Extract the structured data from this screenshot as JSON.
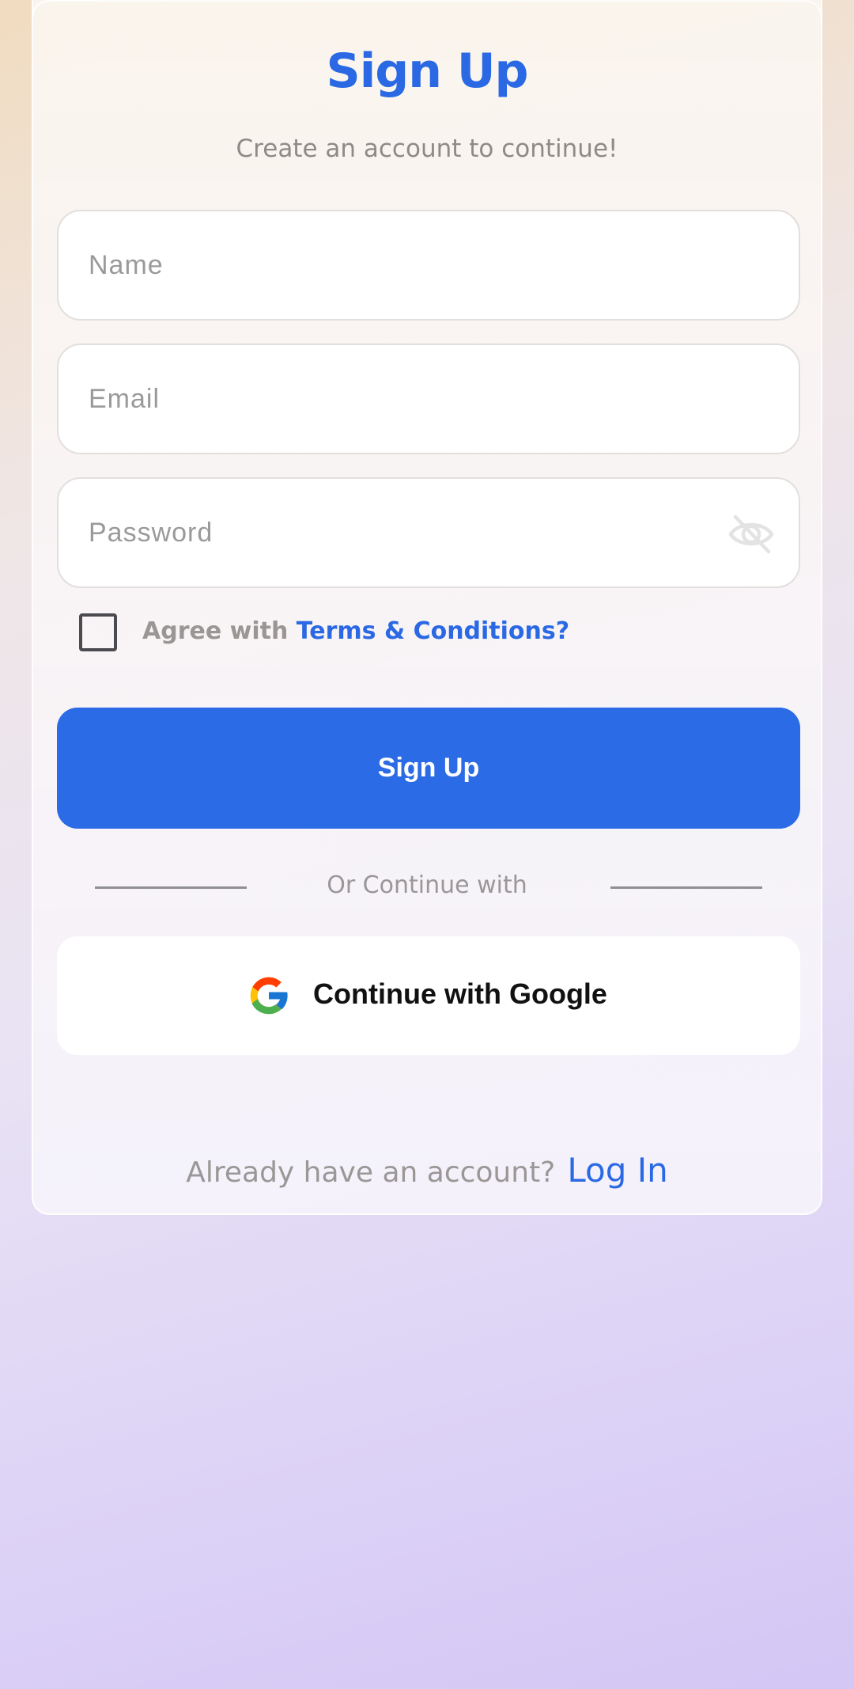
{
  "header": {
    "title": "Sign Up",
    "subtitle": "Create an account to continue!"
  },
  "form": {
    "name_placeholder": "Name",
    "name_value": "",
    "email_placeholder": "Email",
    "email_value": "",
    "password_placeholder": "Password",
    "password_value": "",
    "password_toggle_icon": "eye-off-icon",
    "agree_checked": false,
    "agree_text": "Agree with",
    "terms_link": "Terms & Conditions?",
    "submit_label": "Sign Up"
  },
  "divider": {
    "text": "Or Continue with"
  },
  "google": {
    "label": "Continue with Google",
    "icon": "google-icon"
  },
  "footer": {
    "prompt": "Already have an account?",
    "login_link": "Log In"
  },
  "colors": {
    "accent": "#2B6BE6",
    "title": "#2A69E3",
    "muted_text": "#9B9797"
  }
}
